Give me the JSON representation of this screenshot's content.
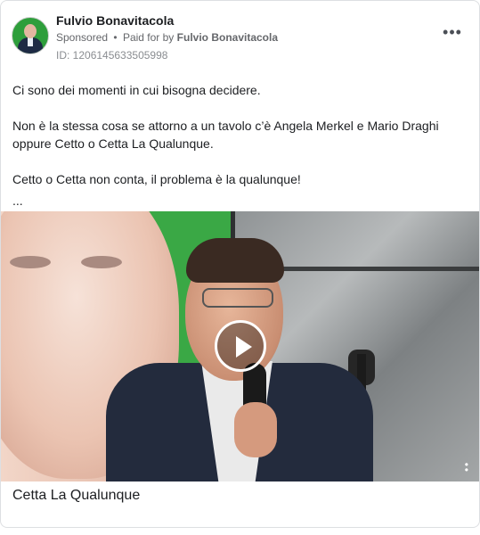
{
  "post": {
    "author_name": "Fulvio Bonavitacola",
    "sponsored_label": "Sponsored",
    "separator": "•",
    "paid_for_prefix": "Paid for by",
    "paid_for_name": "Fulvio Bonavitacola",
    "ad_id": "ID: 1206145633505998",
    "more_icon": "more-horizontal-icon",
    "body_paragraphs": [
      "Ci sono dei momenti in cui bisogna decidere.",
      "Non è la stessa cosa se attorno a un tavolo c’è Angela Merkel e Mario Draghi oppure Cetto o Cetta La Qualunque.",
      "Cetto o Cetta non conta, il problema è la qualunque!"
    ],
    "ellipsis": "...",
    "media": {
      "type": "video",
      "play_icon": "play-icon"
    },
    "caption": "Cetta La Qualunque"
  },
  "colors": {
    "text_primary": "#1c1e21",
    "text_secondary": "#65676b",
    "border": "#dddfe2",
    "poster_green": "#3aa845"
  }
}
